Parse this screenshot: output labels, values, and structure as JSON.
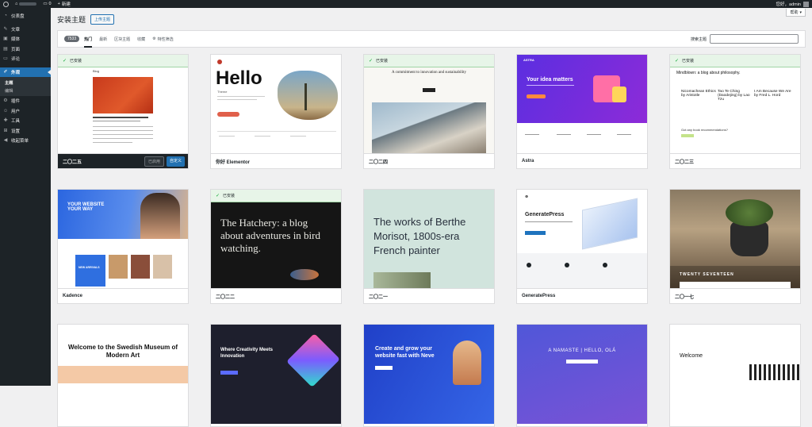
{
  "admin_bar": {
    "count": "0",
    "new_label": "新建",
    "greeting": "您好，admin"
  },
  "sidebar": {
    "items": [
      {
        "label": "仪表盘",
        "icon": "dashboard-icon"
      },
      {
        "label": "文章",
        "icon": "pin-icon"
      },
      {
        "label": "媒体",
        "icon": "media-icon"
      },
      {
        "label": "页面",
        "icon": "page-icon"
      },
      {
        "label": "评论",
        "icon": "comment-icon"
      },
      {
        "label": "外观",
        "icon": "brush-icon"
      },
      {
        "label": "插件",
        "icon": "plugin-icon"
      },
      {
        "label": "用户",
        "icon": "users-icon"
      },
      {
        "label": "工具",
        "icon": "tools-icon"
      },
      {
        "label": "设置",
        "icon": "settings-icon"
      },
      {
        "label": "收起菜单",
        "icon": "collapse-icon"
      }
    ],
    "submenu": [
      {
        "label": "主题"
      },
      {
        "label": "编辑"
      }
    ]
  },
  "header": {
    "title": "安装主题",
    "upload_label": "上传主题",
    "help_label": "帮助"
  },
  "filter": {
    "count": "7533",
    "tabs": [
      "热门",
      "最新",
      "区块主题",
      "收藏"
    ],
    "feature_filter": "特性筛选",
    "search_label": "搜索主题"
  },
  "themes": [
    {
      "name": "二〇二五",
      "installed": true,
      "active_row": true,
      "activated_label": "已启用",
      "customize_label": "自定义",
      "installed_label": "已安装"
    },
    {
      "name": "你好 Elementor",
      "installed": false
    },
    {
      "name": "二〇二四",
      "installed": true,
      "installed_label": "已安装"
    },
    {
      "name": "Astra",
      "installed": false
    },
    {
      "name": "二〇二三",
      "installed": true,
      "installed_label": "已安装"
    },
    {
      "name": "Kadence",
      "installed": false
    },
    {
      "name": "二〇二二",
      "installed": true,
      "installed_label": "已安装"
    },
    {
      "name": "二〇二一",
      "installed": false
    },
    {
      "name": "GeneratePress",
      "installed": false
    },
    {
      "name": "二〇一七",
      "installed": false
    }
  ],
  "previews": {
    "tt5_blog": "Blog",
    "hello_title": "Hello",
    "hello_sub": "Theme",
    "tt4_headline": "A commitment to innovation and sustainability",
    "astra_logo": "ASTRA",
    "astra_headline": "Your idea matters",
    "tt3_headline": "Mindblown: a blog about philosophy.",
    "tt3_post1": "Nicomachean Ethics by Aristotle",
    "tt3_post2": "Tao Te Ching (Daodejing) by Lao Tzu",
    "tt3_post3": "I Am Because We Are by Fred L. Hord",
    "tt3_cta": "Got any book recommendations?",
    "kadence_headline": "YOUR WEBSITE YOUR WAY",
    "kadence_new": "NEW ARRIVALS",
    "tt2_headline": "The Hatchery: a blog about adventures in bird watching.",
    "tt1_headline": "The works of Berthe Morisot, 1800s-era French painter",
    "gp_logo": "GeneratePress",
    "tt17_label": "TWENTY SEVENTEEN",
    "swedish_headline": "Welcome to the Swedish Museum of Modern Art",
    "creativity_headline": "Where Creativity Meets Innovation",
    "neve_headline": "Create and grow your website fast with Neve",
    "namaste": "A NAMASTE | HELLO, OLÁ",
    "welcome": "Welcome"
  }
}
